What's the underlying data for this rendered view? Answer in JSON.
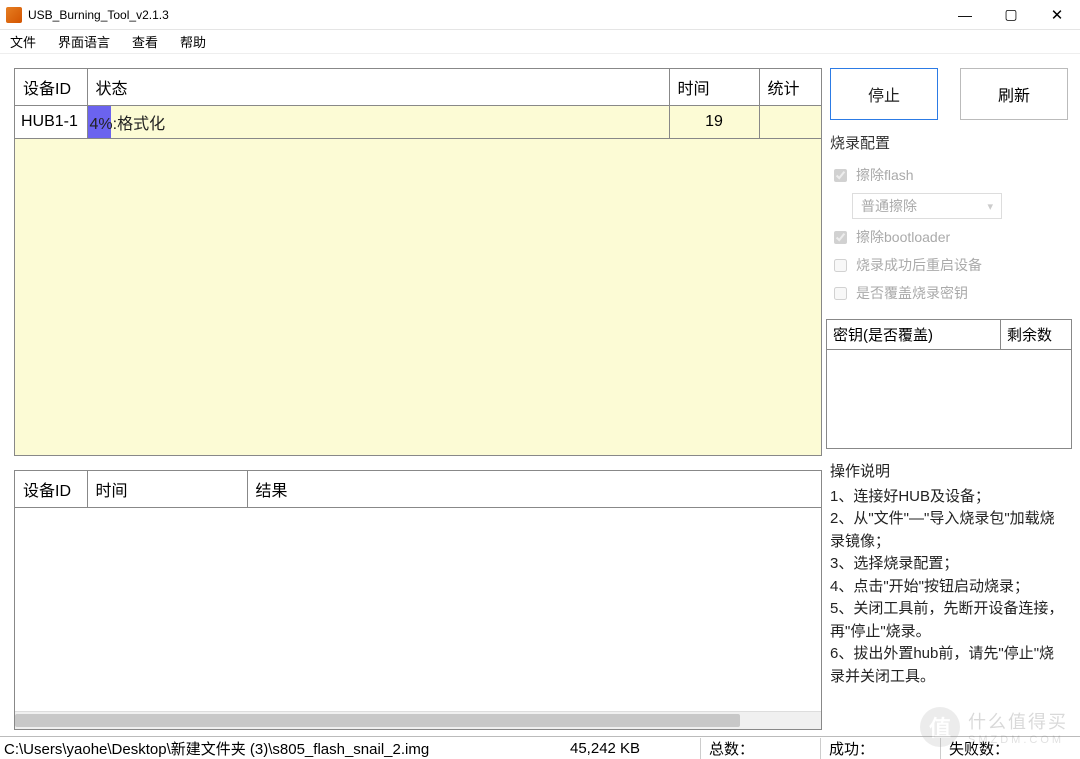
{
  "window": {
    "title": "USB_Burning_Tool_v2.1.3"
  },
  "menu": {
    "file": "文件",
    "lang": "界面语言",
    "view": "查看",
    "help": "帮助"
  },
  "top_table": {
    "headers": {
      "id": "设备ID",
      "status": "状态",
      "time": "时间",
      "stat": "统计"
    },
    "row": {
      "id": "HUB1-1",
      "percent": 4,
      "status_text": "4%:格式化",
      "time": "19",
      "stat": ""
    }
  },
  "bottom_table": {
    "headers": {
      "id": "设备ID",
      "time": "时间",
      "result": "结果"
    }
  },
  "buttons": {
    "stop": "停止",
    "refresh": "刷新"
  },
  "config": {
    "title": "烧录配置",
    "erase_flash": "擦除flash",
    "erase_mode": "普通擦除",
    "erase_bootloader": "擦除bootloader",
    "reboot": "烧录成功后重启设备",
    "overwrite_key": "是否覆盖烧录密钥"
  },
  "key_section": {
    "key": "密钥(是否覆盖)",
    "remain": "剩余数"
  },
  "instructions": {
    "title": "操作说明",
    "s1": "1、连接好HUB及设备；",
    "s2": "2、从\"文件\"—\"导入烧录包\"加载烧录镜像；",
    "s3": "3、选择烧录配置；",
    "s4": "4、点击\"开始\"按钮启动烧录；",
    "s5": "5、关闭工具前，先断开设备连接，再\"停止\"烧录。",
    "s6": "6、拔出外置hub前，请先\"停止\"烧录并关闭工具。"
  },
  "statusbar": {
    "path": "C:\\Users\\yaohe\\Desktop\\新建文件夹 (3)\\s805_flash_snail_2.img",
    "size": "45,242 KB",
    "total": "总数：",
    "success": "成功：",
    "fail": "失败数："
  },
  "watermark": {
    "chars": "值",
    "line1": "什么值得买",
    "line2": "SMZDM.COM"
  }
}
